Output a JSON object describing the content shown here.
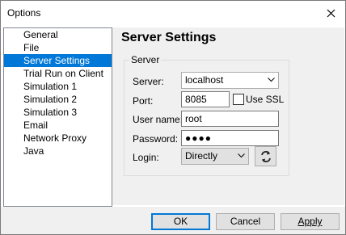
{
  "window": {
    "title": "Options"
  },
  "sidebar": {
    "items": [
      {
        "label": "General",
        "selected": false
      },
      {
        "label": "File",
        "selected": false
      },
      {
        "label": "Server Settings",
        "selected": true
      },
      {
        "label": "Trial Run on Client",
        "selected": false
      },
      {
        "label": "Simulation 1",
        "selected": false
      },
      {
        "label": "Simulation 2",
        "selected": false
      },
      {
        "label": "Simulation 3",
        "selected": false
      },
      {
        "label": "Email",
        "selected": false
      },
      {
        "label": "Network Proxy",
        "selected": false
      },
      {
        "label": "Java",
        "selected": false
      }
    ]
  },
  "main": {
    "title": "Server Settings",
    "group_label": "Server",
    "server": {
      "label": "Server:",
      "value": "localhost"
    },
    "port": {
      "label": "Port:",
      "value": "8085"
    },
    "ssl": {
      "label": "Use SSL",
      "checked": false
    },
    "username": {
      "label": "User name:",
      "value": "root"
    },
    "password": {
      "label": "Password:",
      "value": "●●●●"
    },
    "login": {
      "label": "Login:",
      "value": "Directly"
    }
  },
  "footer": {
    "ok_label": "OK",
    "cancel_label": "Cancel",
    "apply_label": "Apply"
  },
  "colors": {
    "selection": "#0078d7",
    "panel": "#f0f0f0",
    "border": "#adadad"
  },
  "icons": {
    "close": "close-icon",
    "refresh": "refresh-icon",
    "dropdown": "chevron-down-icon"
  }
}
